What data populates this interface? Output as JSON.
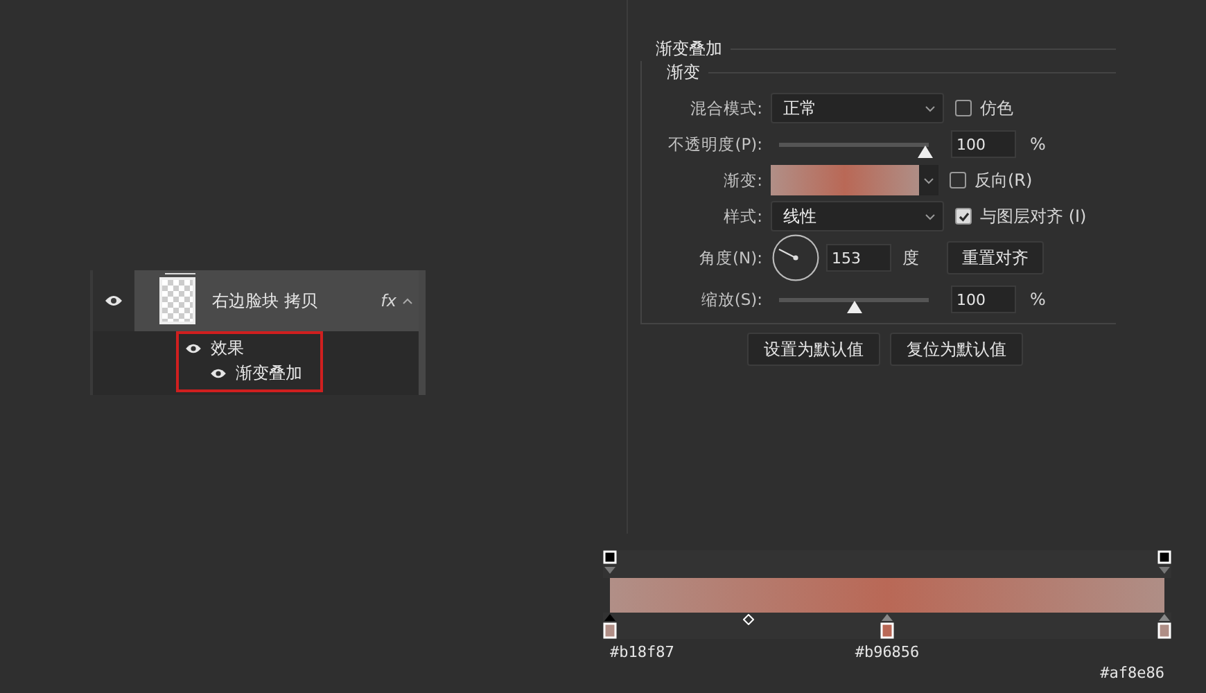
{
  "layer": {
    "name": "右边脸块 拷贝",
    "visible": true,
    "selected": true,
    "fx": "fx",
    "effects_label": "效果",
    "effects_visible": true,
    "effects": [
      {
        "name": "渐变叠加",
        "visible": true
      }
    ]
  },
  "panel": {
    "title": "渐变叠加",
    "group_title": "渐变",
    "controls": [
      {
        "kind": "select",
        "label": "混合模式:",
        "value": "正常",
        "checkbox": {
          "label": "仿色",
          "checked": false
        }
      },
      {
        "kind": "slider",
        "label": "不透明度(P):",
        "level": 1,
        "value": "100",
        "unit": "%"
      },
      {
        "kind": "gradient",
        "label": "渐变:",
        "checkbox": {
          "label": "反向(R)",
          "checked": false
        }
      },
      {
        "kind": "select",
        "label": "样式:",
        "value": "线性",
        "checkbox": {
          "label": "与图层对齐 (I)",
          "checked": true
        }
      },
      {
        "kind": "angle",
        "label": "角度(N):",
        "value": "153",
        "unit": "度",
        "button": "重置对齐"
      },
      {
        "kind": "slider",
        "label": "缩放(S):",
        "level": 0.5,
        "value": "100",
        "unit": "%"
      }
    ],
    "buttons": [
      "设置为默认值",
      "复位为默认值"
    ]
  },
  "gradient_editor": {
    "opacity_stops": [
      {
        "level": 0,
        "selected": false
      },
      {
        "level": 1,
        "selected": false
      }
    ],
    "midpoints": [
      {
        "level": 0.25
      }
    ],
    "color_stops": [
      {
        "level": 0,
        "color": "#b18f87",
        "label": "#b18f87",
        "selected": true
      },
      {
        "level": 0.5,
        "color": "#b96856",
        "label": "#b96856",
        "selected": false
      },
      {
        "level": 1,
        "color": "#af8e86",
        "label": "#af8e86",
        "selected": false
      }
    ]
  }
}
